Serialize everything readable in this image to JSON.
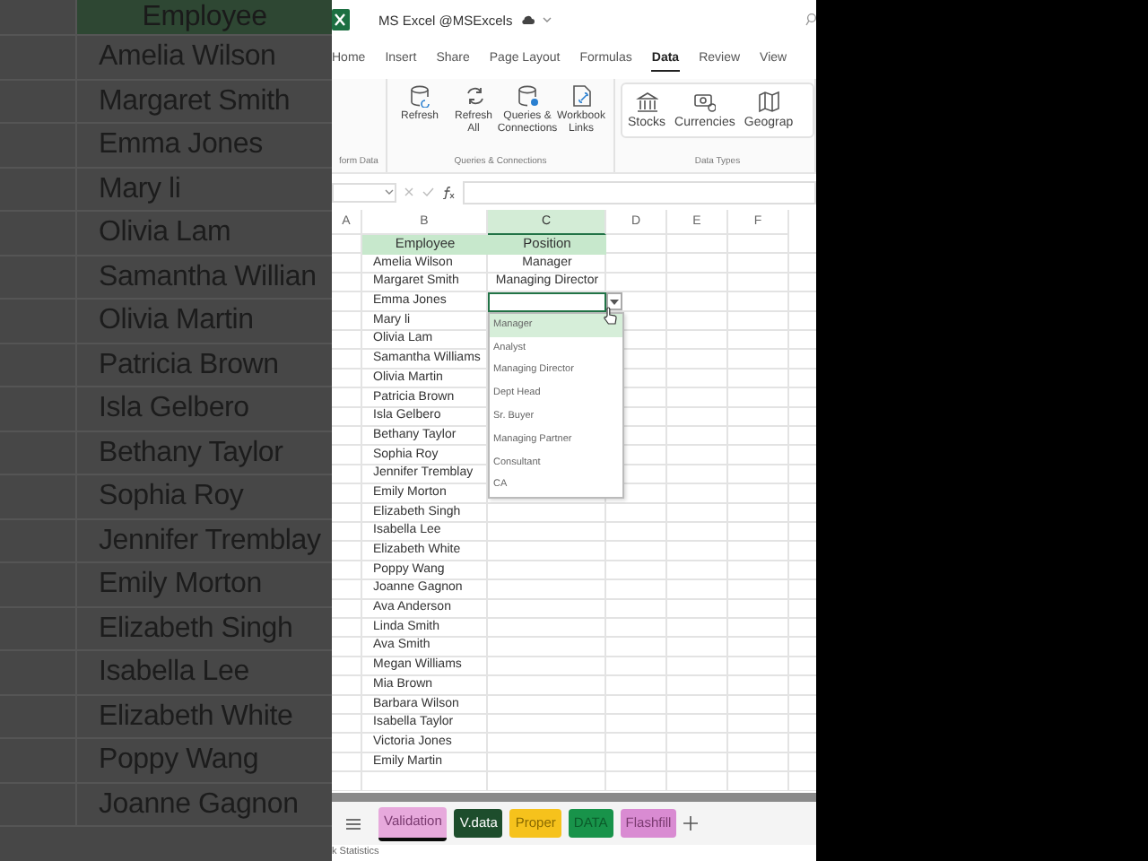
{
  "background_zoom": {
    "column_header": "Employee",
    "names": [
      "Amelia Wilson",
      "Margaret Smith",
      "Emma Jones",
      "Mary li",
      "Olivia Lam",
      "Samantha Willian",
      "Olivia Martin",
      "Patricia Brown",
      "Isla Gelbero",
      "Bethany Taylor",
      "Sophia Roy",
      "Jennifer Tremblay",
      "Emily Morton",
      "Elizabeth Singh",
      "Isabella Lee",
      "Elizabeth White",
      "Poppy Wang",
      "Joanne Gagnon"
    ]
  },
  "window": {
    "title": "MS Excel @MSExcels"
  },
  "ribbon_tabs": [
    {
      "label": "Home",
      "selected": false
    },
    {
      "label": "Insert",
      "selected": false
    },
    {
      "label": "Share",
      "selected": false
    },
    {
      "label": "Page Layout",
      "selected": false
    },
    {
      "label": "Formulas",
      "selected": false
    },
    {
      "label": "Data",
      "selected": true
    },
    {
      "label": "Review",
      "selected": false
    },
    {
      "label": "View",
      "selected": false
    }
  ],
  "ribbon": {
    "groups": [
      {
        "label": "form Data"
      },
      {
        "label": "Queries & Connections",
        "buttons": [
          {
            "label": "Refresh",
            "kind": "refresh-db"
          },
          {
            "label": "Refresh All",
            "kind": "refresh"
          },
          {
            "label": "Queries & Connections",
            "kind": "queries"
          },
          {
            "label": "Workbook Links",
            "kind": "links"
          }
        ]
      },
      {
        "label": "Data Types",
        "buttons": [
          {
            "label": "Stocks",
            "kind": "stocks"
          },
          {
            "label": "Currencies",
            "kind": "currencies"
          },
          {
            "label": "Geograp",
            "kind": "geography"
          }
        ]
      }
    ]
  },
  "grid": {
    "columns": [
      {
        "label": "A",
        "selected": false
      },
      {
        "label": "B",
        "selected": false
      },
      {
        "label": "C",
        "selected": true
      },
      {
        "label": "D",
        "selected": false
      },
      {
        "label": "E",
        "selected": false
      },
      {
        "label": "F",
        "selected": false
      }
    ],
    "header": {
      "employee": "Employee",
      "position": "Position"
    },
    "rows": [
      {
        "employee": "Amelia Wilson",
        "position": "Manager",
        "active": false
      },
      {
        "employee": "Margaret Smith",
        "position": "Managing Director",
        "active": false
      },
      {
        "employee": "Emma Jones",
        "active": true
      },
      {
        "employee": "Mary li",
        "active": false
      },
      {
        "employee": "Olivia Lam",
        "active": false
      },
      {
        "employee": "Samantha Williams",
        "active": false
      },
      {
        "employee": "Olivia Martin",
        "active": false
      },
      {
        "employee": "Patricia Brown",
        "active": false
      },
      {
        "employee": "Isla Gelbero",
        "active": false
      },
      {
        "employee": "Bethany Taylor",
        "active": false
      },
      {
        "employee": "Sophia Roy",
        "active": false
      },
      {
        "employee": "Jennifer Tremblay",
        "active": false
      },
      {
        "employee": "Emily Morton",
        "active": false
      },
      {
        "employee": "Elizabeth Singh",
        "active": false
      },
      {
        "employee": "Isabella Lee",
        "active": false
      },
      {
        "employee": "Elizabeth White",
        "active": false
      },
      {
        "employee": "Poppy Wang",
        "active": false
      },
      {
        "employee": "Joanne Gagnon",
        "active": false
      },
      {
        "employee": "Ava Anderson",
        "active": false
      },
      {
        "employee": "Linda Smith",
        "active": false
      },
      {
        "employee": "Ava Smith",
        "active": false
      },
      {
        "employee": "Megan Williams",
        "active": false
      },
      {
        "employee": "Mia Brown",
        "active": false
      },
      {
        "employee": "Barbara Wilson",
        "active": false
      },
      {
        "employee": "Isabella Taylor",
        "active": false
      },
      {
        "employee": "Victoria Jones",
        "active": false
      },
      {
        "employee": "Emily Martin",
        "active": false
      }
    ]
  },
  "dropdown": {
    "items": [
      {
        "label": "Manager",
        "selected": true
      },
      {
        "label": "Analyst",
        "selected": false
      },
      {
        "label": "Managing Director",
        "selected": false
      },
      {
        "label": "Dept Head",
        "selected": false
      },
      {
        "label": "Sr. Buyer",
        "selected": false
      },
      {
        "label": "Managing Partner",
        "selected": false
      },
      {
        "label": "Consultant",
        "selected": false
      },
      {
        "label": "CA",
        "selected": false
      }
    ]
  },
  "sheet_tabs": [
    {
      "label": "Validation",
      "color": "#e7a9dc",
      "selected": true
    },
    {
      "label": "V.data",
      "color": "#1d4d2c",
      "selected": false
    },
    {
      "label": "Proper",
      "color": "#f6c21c",
      "selected": false
    },
    {
      "label": "DATA",
      "color": "#18934a",
      "selected": false
    },
    {
      "label": "Flashfill",
      "color": "#d98bd2",
      "selected": false
    }
  ],
  "status_bar": "k Statistics"
}
